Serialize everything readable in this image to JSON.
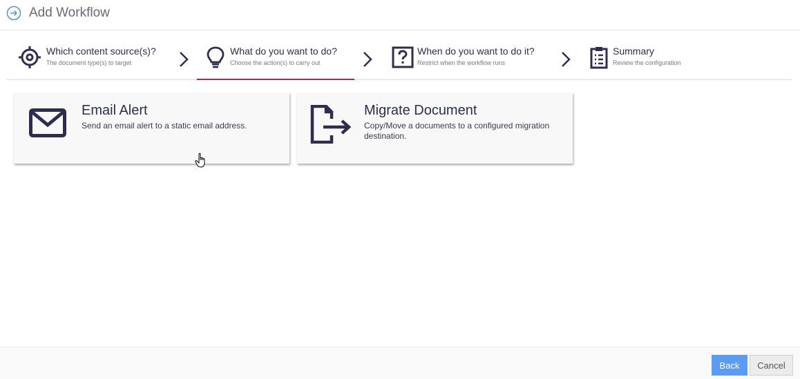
{
  "header": {
    "title": "Add Workflow",
    "icon": "circle-arrow-right-icon"
  },
  "steps": [
    {
      "label": "Which content source(s)?",
      "sub": "The document type(s) to target",
      "icon": "target-icon",
      "active": false
    },
    {
      "label": "What do you want to do?",
      "sub": "Choose the action(s) to carry out",
      "icon": "lightbulb-icon",
      "active": true
    },
    {
      "label": "When do you want to do it?",
      "sub": "Restrict when the workflow runs",
      "icon": "question-box-icon",
      "active": false
    },
    {
      "label": "Summary",
      "sub": "Review the configuration",
      "icon": "clipboard-list-icon",
      "active": false
    }
  ],
  "actions": [
    {
      "title": "Email Alert",
      "desc": "Send an email alert to a static email address.",
      "icon": "envelope-icon"
    },
    {
      "title": "Migrate Document",
      "desc": "Copy/Move a documents to a configured migration destination.",
      "icon": "file-export-icon"
    }
  ],
  "footer": {
    "back_label": "Back",
    "cancel_label": "Cancel"
  },
  "colors": {
    "accent": "#c2185b",
    "primary": "#5b9cf2",
    "icon": "#2e2d4d"
  }
}
